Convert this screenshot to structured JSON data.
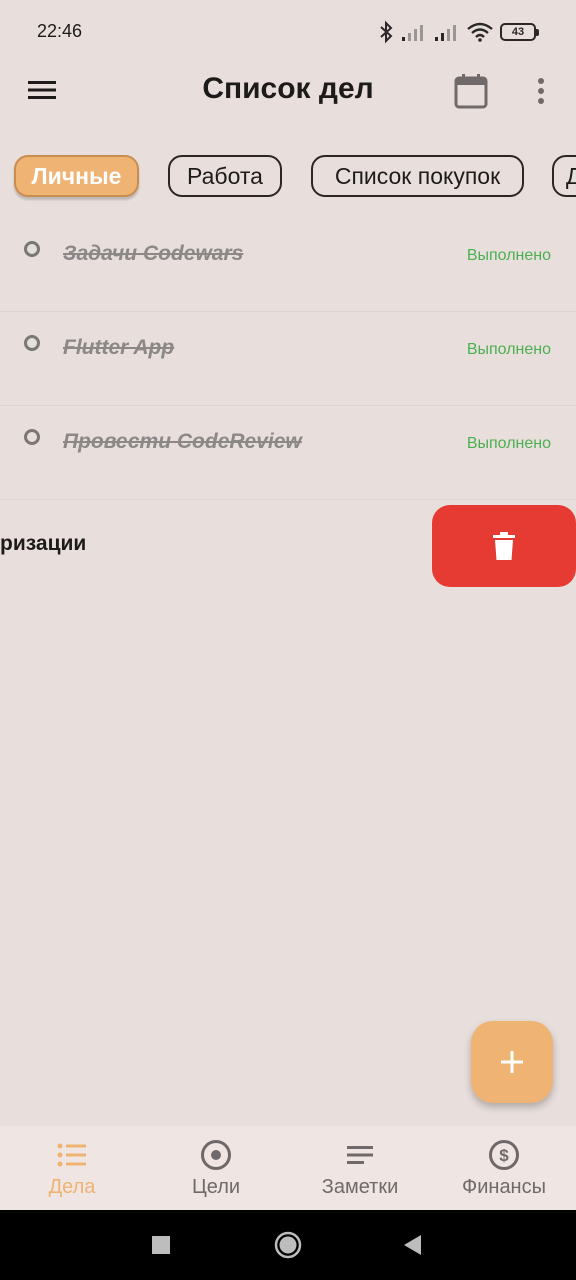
{
  "status_bar": {
    "time": "22:46",
    "battery": "43",
    "icons": [
      "bluetooth-icon",
      "signal-icon",
      "signal-icon",
      "wifi-icon",
      "battery-icon"
    ]
  },
  "app_bar": {
    "title": "Список дел",
    "icons": [
      "menu-icon",
      "calendar-icon",
      "more-vertical-icon"
    ]
  },
  "categories": [
    {
      "label": "Личные",
      "active": true
    },
    {
      "label": "Работа",
      "active": false
    },
    {
      "label": "Список покупок",
      "active": false
    },
    {
      "label": "Д",
      "active": false
    }
  ],
  "tasks": [
    {
      "title": "Задачи Codewars",
      "status": "Выполнено"
    },
    {
      "title": "Flutter App",
      "status": "Выполнено"
    },
    {
      "title": "Провести CodeReview",
      "status": "Выполнено"
    }
  ],
  "swiped_task": {
    "title_visible": "ризации",
    "action_icon": "trash-icon"
  },
  "fab": {
    "icon": "plus-icon"
  },
  "bottom_nav": [
    {
      "label": "Дела",
      "icon": "list-icon",
      "active": true
    },
    {
      "label": "Цели",
      "icon": "target-icon",
      "active": false
    },
    {
      "label": "Заметки",
      "icon": "notes-icon",
      "active": false
    },
    {
      "label": "Финансы",
      "icon": "dollar-icon",
      "active": false
    }
  ],
  "colors": {
    "background": "#e8dfdc",
    "accent": "#efb373",
    "done": "#4caf50",
    "delete": "#e53b32"
  }
}
